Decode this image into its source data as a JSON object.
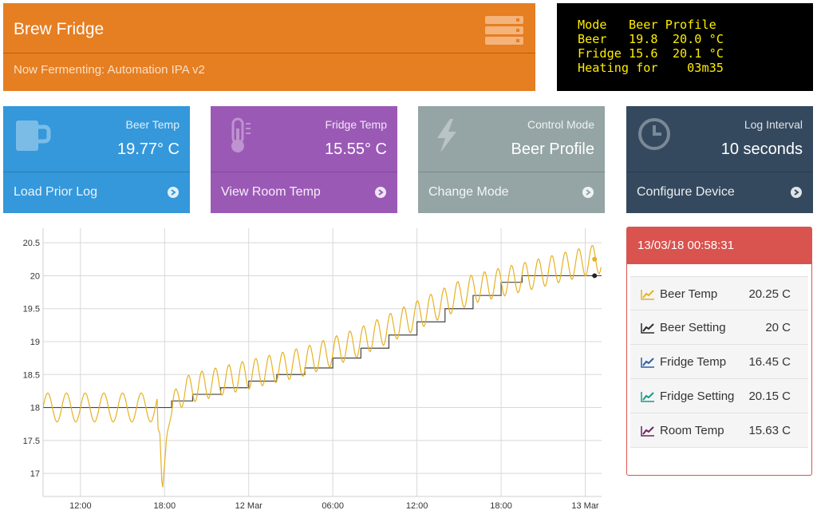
{
  "header": {
    "title": "Brew Fridge",
    "subtitle": "Now Fermenting: Automation IPA v2",
    "color": "#e67e22"
  },
  "lcd": {
    "lines": [
      "Mode   Beer Profile",
      "Beer   19.8  20.0 °C",
      "Fridge 15.6  20.1 °C",
      "Heating for    03m35"
    ]
  },
  "cards": [
    {
      "label": "Beer Temp",
      "value": "19.77° C",
      "link": "Load Prior Log",
      "icon": "beer-mug-icon",
      "color": "#3498db"
    },
    {
      "label": "Fridge Temp",
      "value": "15.55° C",
      "link": "View Room Temp",
      "icon": "thermometer-icon",
      "color": "#9b59b6"
    },
    {
      "label": "Control Mode",
      "value": "Beer Profile",
      "link": "Change Mode",
      "icon": "lightning-icon",
      "color": "#95a5a6"
    },
    {
      "label": "Log Interval",
      "value": "10 seconds",
      "link": "Configure Device",
      "icon": "clock-icon",
      "color": "#34495e"
    }
  ],
  "status": {
    "timestamp": "13/03/18 00:58:31",
    "color": "#d9534f",
    "rows": [
      {
        "name": "Beer Temp",
        "value": "20.25 C",
        "color": "#e6b222"
      },
      {
        "name": "Beer Setting",
        "value": "20 C",
        "color": "#2c2c2c"
      },
      {
        "name": "Fridge Temp",
        "value": "16.45 C",
        "color": "#2c5ea8"
      },
      {
        "name": "Fridge Setting",
        "value": "20.15 C",
        "color": "#1a9a8a"
      },
      {
        "name": "Room Temp",
        "value": "15.63 C",
        "color": "#6b2462"
      }
    ]
  },
  "chart_data": {
    "type": "line",
    "xlabel": "",
    "ylabel": "",
    "x_ticks": [
      "12:00",
      "18:00",
      "12 Mar",
      "06:00",
      "12:00",
      "18:00",
      "13 Mar"
    ],
    "x_range": [
      "2018-03-11 09:20",
      "2018-03-13 01:10"
    ],
    "y_ticks": [
      17,
      17.5,
      18,
      18.5,
      19,
      19.5,
      20,
      20.5
    ],
    "ylim": [
      16.65,
      20.72
    ],
    "grid": true,
    "series": [
      {
        "name": "Beer Setting",
        "color": "#444444",
        "points": [
          [
            "2018-03-11 09:20",
            18.0
          ],
          [
            "2018-03-11 18:00",
            18.0
          ],
          [
            "2018-03-11 18:30",
            18.1
          ],
          [
            "2018-03-11 20:00",
            18.2
          ],
          [
            "2018-03-11 22:00",
            18.3
          ],
          [
            "2018-03-12 00:00",
            18.4
          ],
          [
            "2018-03-12 02:00",
            18.5
          ],
          [
            "2018-03-12 04:00",
            18.6
          ],
          [
            "2018-03-12 06:00",
            18.75
          ],
          [
            "2018-03-12 08:00",
            18.9
          ],
          [
            "2018-03-12 10:00",
            19.1
          ],
          [
            "2018-03-12 12:00",
            19.3
          ],
          [
            "2018-03-12 14:00",
            19.5
          ],
          [
            "2018-03-12 16:00",
            19.7
          ],
          [
            "2018-03-12 18:00",
            19.9
          ],
          [
            "2018-03-12 19:30",
            20.0
          ],
          [
            "2018-03-13 01:10",
            20.0
          ]
        ]
      },
      {
        "name": "Beer Temp",
        "color": "#e6b222",
        "points": [
          [
            "2018-03-11 09:20",
            18.0
          ],
          [
            "2018-03-11 10:00",
            18.2
          ],
          [
            "2018-03-11 10:40",
            17.8
          ],
          [
            "2018-03-11 11:20",
            18.2
          ],
          [
            "2018-03-11 12:00",
            17.8
          ],
          [
            "2018-03-11 12:40",
            18.2
          ],
          [
            "2018-03-11 13:20",
            17.8
          ],
          [
            "2018-03-11 14:00",
            18.2
          ],
          [
            "2018-03-11 14:40",
            17.8
          ],
          [
            "2018-03-11 15:20",
            18.2
          ],
          [
            "2018-03-11 16:00",
            17.8
          ],
          [
            "2018-03-11 16:40",
            18.2
          ],
          [
            "2018-03-11 17:20",
            17.8
          ],
          [
            "2018-03-11 17:40",
            17.6
          ],
          [
            "2018-03-11 17:50",
            16.7
          ],
          [
            "2018-03-11 18:10",
            17.6
          ],
          [
            "2018-03-11 18:30",
            17.9
          ],
          [
            "2018-03-11 19:00",
            18.2
          ],
          [
            "2018-03-11 20:00",
            18.3
          ],
          [
            "2018-03-11 22:00",
            18.4
          ],
          [
            "2018-03-12 00:00",
            18.5
          ],
          [
            "2018-03-12 04:00",
            18.7
          ],
          [
            "2018-03-12 08:00",
            19.0
          ],
          [
            "2018-03-12 12:00",
            19.4
          ],
          [
            "2018-03-12 16:00",
            19.8
          ],
          [
            "2018-03-12 20:00",
            20.0
          ],
          [
            "2018-03-13 00:40",
            20.25
          ]
        ]
      }
    ]
  }
}
